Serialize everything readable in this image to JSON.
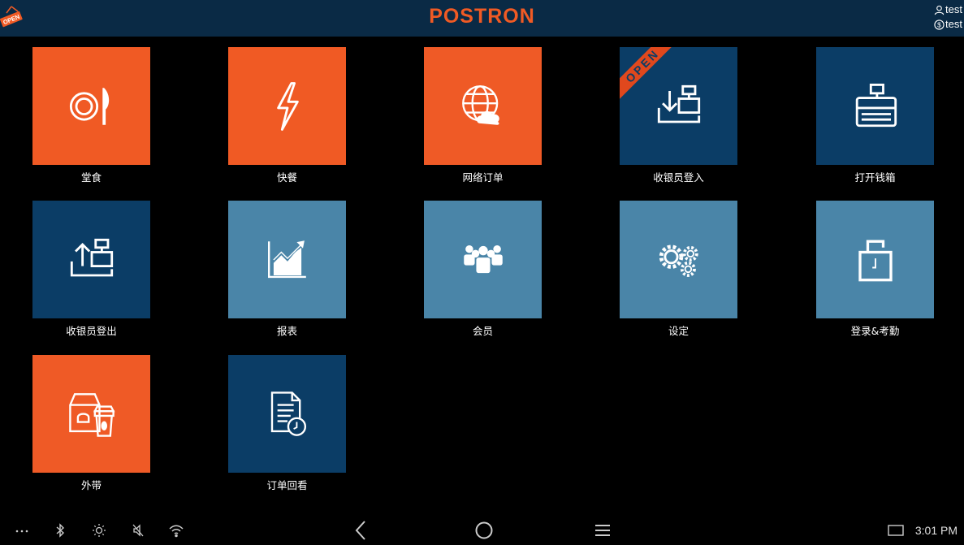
{
  "header": {
    "open_badge": "OPEN",
    "logo": "POSTRON",
    "user": "test",
    "shop": "test"
  },
  "tiles": [
    {
      "label": "堂食",
      "icon": "dine-in-icon",
      "color": "#f05a24"
    },
    {
      "label": "快餐",
      "icon": "lightning-icon",
      "color": "#f05a24"
    },
    {
      "label": "网络订单",
      "icon": "globe-cloud-icon",
      "color": "#f05a24"
    },
    {
      "label": "收银员登入",
      "icon": "cashier-login-icon",
      "color": "#0b3d66",
      "ribbon": "OPEN"
    },
    {
      "label": "打开钱箱",
      "icon": "cash-drawer-icon",
      "color": "#0b3d66"
    },
    {
      "label": "收银员登出",
      "icon": "cashier-logout-icon",
      "color": "#0b3d66"
    },
    {
      "label": "报表",
      "icon": "report-chart-icon",
      "color": "#4a85a8"
    },
    {
      "label": "会员",
      "icon": "members-icon",
      "color": "#4a85a8"
    },
    {
      "label": "设定",
      "icon": "gears-icon",
      "color": "#4a85a8"
    },
    {
      "label": "登录&考勤",
      "icon": "attendance-clock-icon",
      "color": "#4a85a8"
    },
    {
      "label": "外带",
      "icon": "takeaway-bag-icon",
      "color": "#f05a24"
    },
    {
      "label": "订单回看",
      "icon": "order-history-icon",
      "color": "#0b3d66"
    }
  ],
  "system_bar": {
    "time": "3:01 PM"
  }
}
